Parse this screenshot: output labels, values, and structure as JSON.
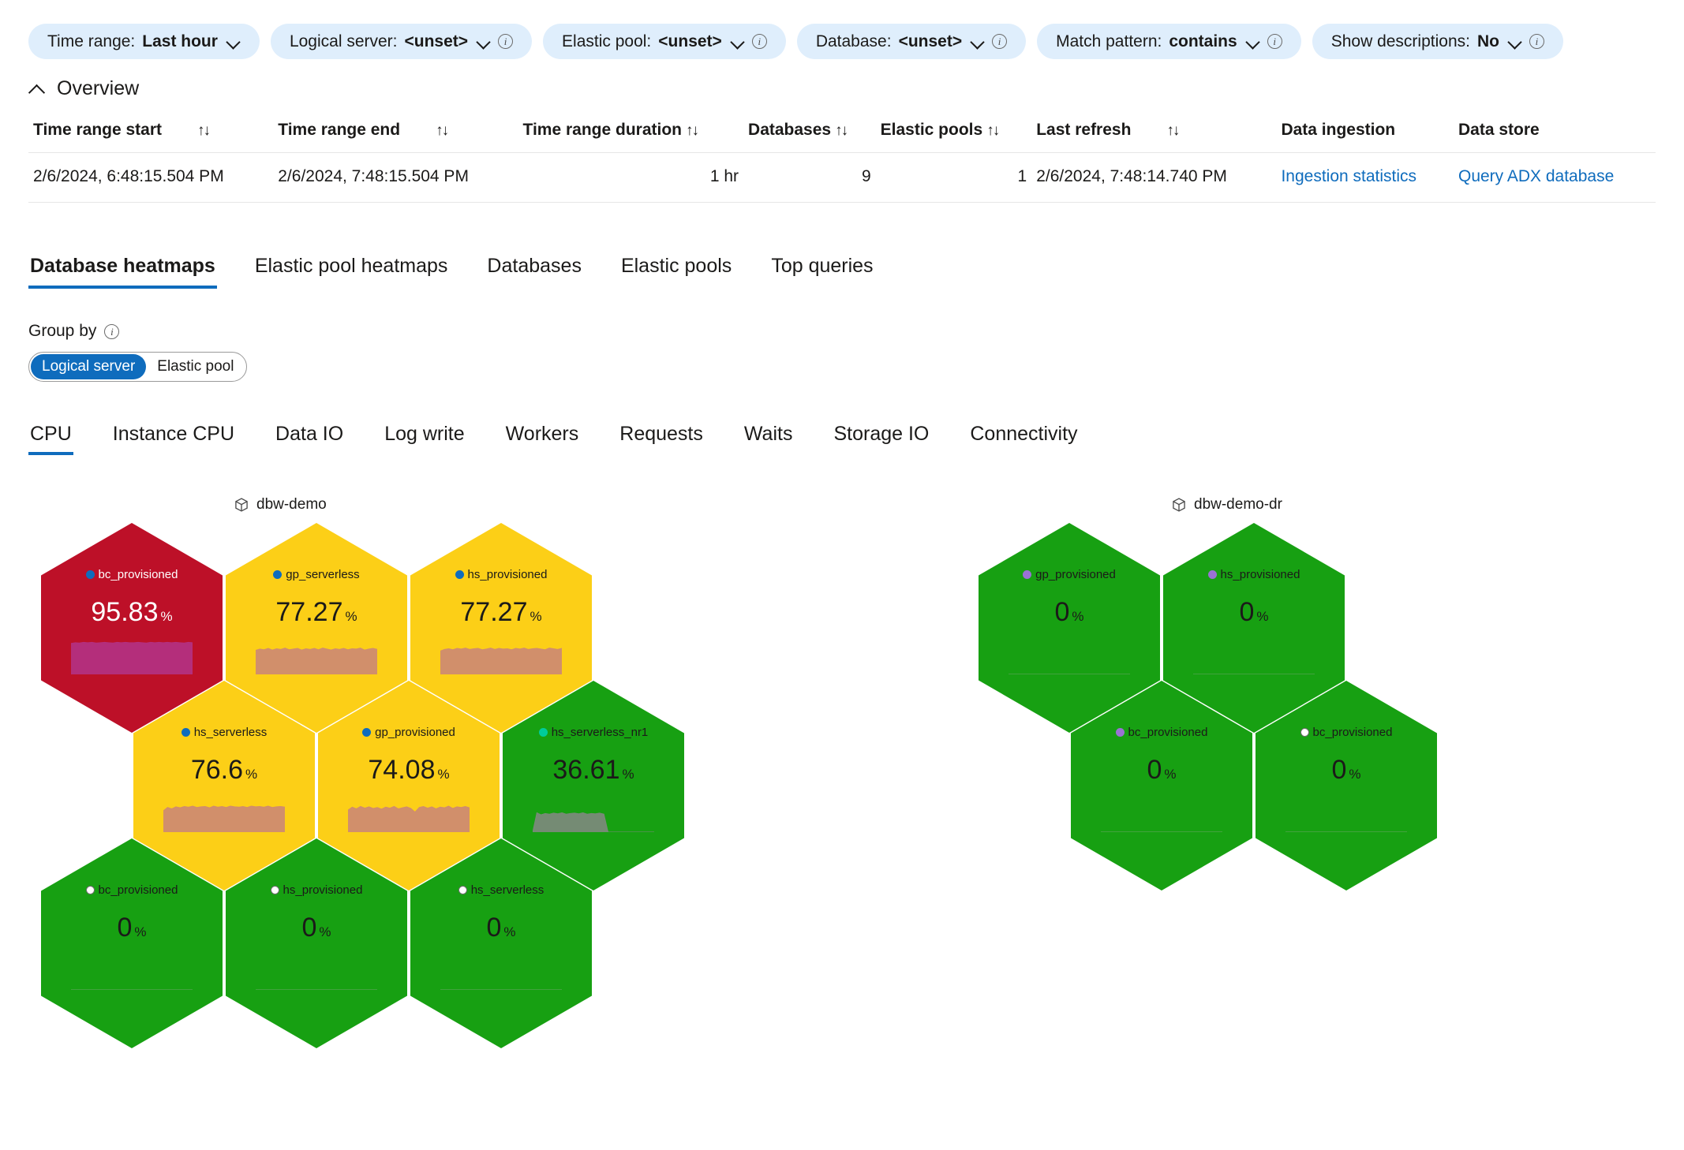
{
  "filters": [
    {
      "label": "Time range:",
      "value": "Last hour",
      "has_info": false
    },
    {
      "label": "Logical server:",
      "value": "<unset>",
      "has_info": true
    },
    {
      "label": "Elastic pool:",
      "value": "<unset>",
      "has_info": true
    },
    {
      "label": "Database:",
      "value": "<unset>",
      "has_info": true
    },
    {
      "label": "Match pattern:",
      "value": "contains",
      "has_info": true
    },
    {
      "label": "Show descriptions:",
      "value": "No",
      "has_info": true
    }
  ],
  "overview": {
    "title": "Overview",
    "columns": [
      {
        "label": "Time range start",
        "sortable": true,
        "align": "left"
      },
      {
        "label": "Time range end",
        "sortable": true,
        "align": "left"
      },
      {
        "label": "Time range duration",
        "sortable": true,
        "align": "right"
      },
      {
        "label": "Databases",
        "sortable": true,
        "align": "right"
      },
      {
        "label": "Elastic pools",
        "sortable": true,
        "align": "right"
      },
      {
        "label": "Last refresh",
        "sortable": true,
        "align": "left"
      },
      {
        "label": "Data ingestion",
        "sortable": false,
        "align": "left"
      },
      {
        "label": "Data store",
        "sortable": false,
        "align": "left"
      }
    ],
    "row": {
      "time_range_start": "2/6/2024, 6:48:15.504 PM",
      "time_range_end": "2/6/2024, 7:48:15.504 PM",
      "time_range_duration": "1 hr",
      "databases": "9",
      "elastic_pools": "1",
      "last_refresh": "2/6/2024, 7:48:14.740 PM",
      "data_ingestion_link": "Ingestion statistics",
      "data_store_link": "Query ADX database"
    },
    "sort_icon": "↑↓"
  },
  "tabs": [
    {
      "label": "Database heatmaps",
      "active": true
    },
    {
      "label": "Elastic pool heatmaps",
      "active": false
    },
    {
      "label": "Databases",
      "active": false
    },
    {
      "label": "Elastic pools",
      "active": false
    },
    {
      "label": "Top queries",
      "active": false
    }
  ],
  "group_by": {
    "label": "Group by",
    "options": [
      {
        "label": "Logical server",
        "selected": true
      },
      {
        "label": "Elastic pool",
        "selected": false
      }
    ]
  },
  "metric_tabs": [
    {
      "label": "CPU",
      "active": true
    },
    {
      "label": "Instance CPU",
      "active": false
    },
    {
      "label": "Data IO",
      "active": false
    },
    {
      "label": "Log write",
      "active": false
    },
    {
      "label": "Workers",
      "active": false
    },
    {
      "label": "Requests",
      "active": false
    },
    {
      "label": "Waits",
      "active": false
    },
    {
      "label": "Storage IO",
      "active": false
    },
    {
      "label": "Connectivity",
      "active": false
    }
  ],
  "colors": {
    "critical": "#bd1028",
    "warning": "#fccf17",
    "healthy": "#17a012",
    "accent": "#0f6cbd",
    "pill_bg": "#dfeefc",
    "dot_blue": "#0f6cbd",
    "dot_teal": "#00cc9b",
    "dot_purple": "#9a72d4",
    "dot_white": "#ffffff",
    "spark_critical": "#b33080",
    "spark_warning": "#cf8b70",
    "spark_healthy": "#7a8a7a"
  },
  "chart_data": {
    "type": "heatmap",
    "title": "CPU",
    "unit": "%",
    "legend_position": "none",
    "groups": [
      {
        "name": "dbw-demo",
        "icon": "cube-icon",
        "cells": [
          {
            "label": "bc_provisioned",
            "value": 95.83,
            "display": "95.83",
            "status": "critical",
            "dot": "blue",
            "col": 0,
            "row": 0,
            "sparkline": [
              93,
              95,
              94,
              96,
              95,
              96,
              94,
              95,
              96,
              95,
              94,
              96,
              95,
              96,
              95,
              95,
              96,
              95,
              94,
              96,
              95,
              96,
              95,
              96,
              95,
              96,
              95,
              94,
              96,
              95
            ]
          },
          {
            "label": "gp_serverless",
            "value": 77.27,
            "display": "77.27",
            "status": "warning",
            "dot": "blue",
            "col": 1,
            "row": 0,
            "sparkline": [
              72,
              76,
              74,
              78,
              73,
              77,
              75,
              79,
              74,
              76,
              78,
              73,
              77,
              75,
              78,
              74,
              79,
              76,
              73,
              77,
              75,
              78,
              74,
              77,
              76,
              79,
              73,
              76,
              78,
              75
            ]
          },
          {
            "label": "hs_provisioned",
            "value": 77.27,
            "display": "77.27",
            "status": "warning",
            "dot": "blue",
            "col": 2,
            "row": 0,
            "sparkline": [
              70,
              75,
              77,
              74,
              78,
              76,
              79,
              75,
              77,
              78,
              74,
              76,
              79,
              75,
              78,
              76,
              77,
              74,
              78,
              76,
              79,
              75,
              77,
              78,
              76,
              74,
              79,
              77,
              75,
              78
            ]
          },
          {
            "label": "hs_serverless",
            "value": 76.6,
            "display": "76.6",
            "status": "warning",
            "dot": "blue",
            "col": 0,
            "row": 1,
            "sparkline": [
              64,
              74,
              70,
              76,
              73,
              77,
              75,
              78,
              74,
              76,
              77,
              73,
              78,
              75,
              77,
              74,
              78,
              76,
              75,
              77,
              74,
              78,
              76,
              77,
              75,
              78,
              74,
              76,
              77,
              75
            ]
          },
          {
            "label": "gp_provisioned",
            "value": 74.08,
            "display": "74.08",
            "status": "warning",
            "dot": "blue",
            "col": 1,
            "row": 1,
            "sparkline": [
              66,
              75,
              70,
              77,
              72,
              76,
              71,
              74,
              69,
              75,
              72,
              77,
              70,
              73,
              76,
              71,
              60,
              74,
              77,
              72,
              76,
              70,
              75,
              73,
              78,
              71,
              76,
              74,
              77,
              73
            ]
          },
          {
            "label": "hs_serverless_nr1",
            "value": 36.61,
            "display": "36.61",
            "status": "healthy",
            "dot": "teal",
            "col": 2,
            "row": 1,
            "sparkline": [
              0,
              58,
              52,
              56,
              54,
              57,
              55,
              58,
              54,
              56,
              57,
              55,
              58,
              54,
              56,
              55,
              57,
              54,
              0,
              0,
              0,
              0,
              0,
              0,
              0,
              0,
              0,
              0,
              0,
              0
            ]
          },
          {
            "label": "bc_provisioned",
            "value": 0,
            "display": "0",
            "status": "healthy",
            "dot": "white",
            "col": 0,
            "row": 2,
            "sparkline": [
              0,
              0,
              0,
              0,
              0,
              0,
              0,
              0,
              0,
              0,
              0,
              0,
              0,
              0,
              0,
              0,
              0,
              0,
              0,
              0,
              0,
              0,
              0,
              0,
              0,
              0,
              0,
              0,
              0,
              0
            ]
          },
          {
            "label": "hs_provisioned",
            "value": 0,
            "display": "0",
            "status": "healthy",
            "dot": "white",
            "col": 1,
            "row": 2,
            "sparkline": [
              0,
              0,
              0,
              0,
              0,
              0,
              0,
              0,
              0,
              0,
              0,
              0,
              0,
              0,
              0,
              0,
              0,
              0,
              0,
              0,
              0,
              0,
              0,
              0,
              0,
              0,
              0,
              0,
              0,
              0
            ]
          },
          {
            "label": "hs_serverless",
            "value": 0,
            "display": "0",
            "status": "healthy",
            "dot": "white",
            "col": 2,
            "row": 2,
            "sparkline": [
              0,
              0,
              0,
              0,
              0,
              0,
              0,
              0,
              0,
              0,
              0,
              0,
              0,
              0,
              0,
              0,
              0,
              0,
              0,
              0,
              0,
              0,
              0,
              0,
              0,
              0,
              0,
              0,
              0,
              0
            ]
          }
        ]
      },
      {
        "name": "dbw-demo-dr",
        "icon": "cube-icon",
        "cells": [
          {
            "label": "gp_provisioned",
            "value": 0,
            "display": "0",
            "status": "healthy",
            "dot": "purple",
            "col": 0,
            "row": 0,
            "sparkline": [
              0,
              0,
              0,
              0,
              0,
              0,
              0,
              0,
              0,
              0,
              0,
              0,
              0,
              0,
              0,
              0,
              0,
              0,
              0,
              0,
              0,
              0,
              0,
              0,
              0,
              0,
              0,
              0,
              0,
              0
            ]
          },
          {
            "label": "hs_provisioned",
            "value": 0,
            "display": "0",
            "status": "healthy",
            "dot": "purple",
            "col": 1,
            "row": 0,
            "sparkline": [
              0,
              0,
              0,
              0,
              0,
              0,
              0,
              0,
              0,
              0,
              0,
              0,
              0,
              0,
              0,
              0,
              0,
              0,
              0,
              0,
              0,
              0,
              0,
              0,
              0,
              0,
              0,
              0,
              0,
              0
            ]
          },
          {
            "label": "bc_provisioned",
            "value": 0,
            "display": "0",
            "status": "healthy",
            "dot": "purple",
            "col": 0,
            "row": 1,
            "sparkline": [
              0,
              0,
              0,
              0,
              0,
              0,
              0,
              0,
              0,
              0,
              0,
              0,
              0,
              0,
              0,
              0,
              0,
              0,
              0,
              0,
              0,
              0,
              0,
              0,
              0,
              0,
              0,
              0,
              0,
              0
            ]
          },
          {
            "label": "bc_provisioned",
            "value": 0,
            "display": "0",
            "status": "healthy",
            "dot": "white",
            "col": 1,
            "row": 1,
            "sparkline": [
              0,
              0,
              0,
              0,
              0,
              0,
              0,
              0,
              0,
              0,
              0,
              0,
              0,
              0,
              0,
              0,
              0,
              0,
              0,
              0,
              0,
              0,
              0,
              0,
              0,
              0,
              0,
              0,
              0,
              0
            ]
          }
        ]
      }
    ]
  }
}
